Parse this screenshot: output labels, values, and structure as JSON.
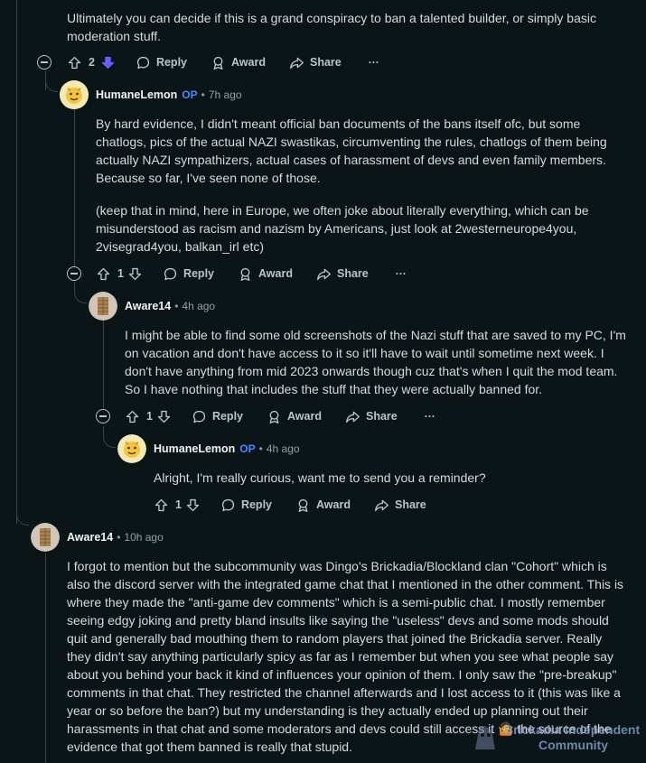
{
  "top_comment": {
    "text": "Ultimately you can decide if this is a grand conspiracy to ban a talented builder, or simply basic moderation stuff.",
    "votes": "2"
  },
  "actions": {
    "reply": "Reply",
    "award": "Award",
    "share": "Share",
    "more": "···"
  },
  "comments": [
    {
      "username": "HumaneLemon",
      "op": "OP",
      "sep": "•",
      "time": "7h ago",
      "p1": "By hard evidence, I didn't meant official ban documents of the bans itself ofc, but some chatlogs, pics of the actual NAZI swastikas, circumventing the rules, chatlogs of them being actually NAZI sympathizers, actual cases of harassment of devs and even family members. Because so far, I've seen none of those.",
      "p2": "(keep that in mind, here in Europe, we often joke about literally everything, which can be misunderstood as racism and nazism by Americans, just look at 2westerneurope4you, 2visegrad4you, balkan_irl etc)",
      "votes": "1"
    },
    {
      "username": "Aware14",
      "sep": "•",
      "time": "4h ago",
      "p1": "I might be able to find some old screenshots of the Nazi stuff that are saved to my PC, I'm on vacation and don't have access to it so it'll have to wait until sometime next week. I don't have anything from mid 2023 onwards though cuz that's when I quit the mod team. So I have nothing that includes the stuff that they were actually banned for.",
      "votes": "1"
    },
    {
      "username": "HumaneLemon",
      "op": "OP",
      "sep": "•",
      "time": "4h ago",
      "p1": "Alright, I'm really curious, want me to send you a reminder?",
      "votes": "1"
    },
    {
      "username": "Aware14",
      "sep": "•",
      "time": "10h ago",
      "p1": "I forgot to mention but the subcommunity was Dingo's Brickadia/Blockland clan \"Cohort\" which is also the discord server with the integrated game chat that I mentioned in the other comment. This is where they made the \"anti-game dev comments\" which is a semi-public chat. I mostly remember seeing edgy joking and pretty bland insults like saying the \"useless\" devs and some mods should quit and generally bad mouthing them to random players that joined the Brickadia server. Really they didn't say anything particularly spicy as far as I remember but when you see what people say about you behind your back it kind of influences your opinion of them. I only saw the \"pre-breakup\" comments in that chat. They restricted the channel afterwards and I lost access to it (this was like a year or so before the ban?) but my understanding is they actually ended up planning out their harassments in that chat and some moderators and devs could still access it 🤷 the source of the evidence that got them banned is really that stupid."
    }
  ],
  "watermark": {
    "line1": "Brickadia Independent",
    "line2": "Community"
  },
  "colors": {
    "background": "#0b1416",
    "op": "#3f8cff",
    "downvote_active": "#6a5cff",
    "text": "#d7dadc"
  }
}
